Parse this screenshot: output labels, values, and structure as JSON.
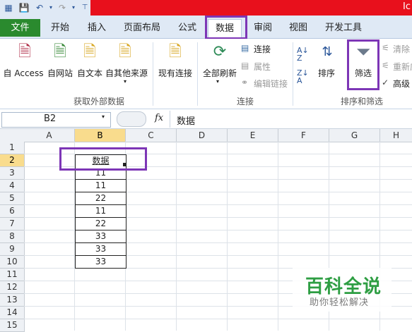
{
  "title_bar": {
    "title_fragment": "Ic",
    "quick_access": [
      "save-icon",
      "undo-icon",
      "redo-icon",
      "customize-icon"
    ]
  },
  "tabs": [
    "文件",
    "开始",
    "插入",
    "页面布局",
    "公式",
    "数据",
    "审阅",
    "视图",
    "开发工具"
  ],
  "active_tab": "数据",
  "ribbon": {
    "get_external": {
      "buttons": [
        "自 Access",
        "自网站",
        "自文本",
        "自其他来源",
        "现有连接"
      ],
      "group_label": "获取外部数据"
    },
    "connections": {
      "big_button": "全部刷新",
      "small": [
        "连接",
        "属性",
        "编辑链接"
      ],
      "group_label": "连接"
    },
    "sort_filter": {
      "sort_label": "排序",
      "filter_label": "筛选",
      "small": [
        "清除",
        "重新应用",
        "高级"
      ],
      "group_label": "排序和筛选"
    }
  },
  "formula_bar": {
    "name_box": "B2",
    "fx": "fx",
    "content": "数据"
  },
  "columns": [
    "A",
    "B",
    "C",
    "D",
    "E",
    "F",
    "G",
    "H"
  ],
  "rows": [
    "1",
    "2",
    "3",
    "4",
    "5",
    "6",
    "7",
    "8",
    "9",
    "10",
    "11",
    "12",
    "13",
    "14",
    "15"
  ],
  "column_b": {
    "header": "数据",
    "values": [
      "11",
      "11",
      "22",
      "11",
      "22",
      "33",
      "33",
      "33"
    ]
  },
  "watermark": {
    "main": "百科全说",
    "sub": "助你轻松解决"
  },
  "colors": {
    "accent_red": "#e8101c",
    "file_tab": "#2a8a2e",
    "highlight": "#7d36b6"
  }
}
